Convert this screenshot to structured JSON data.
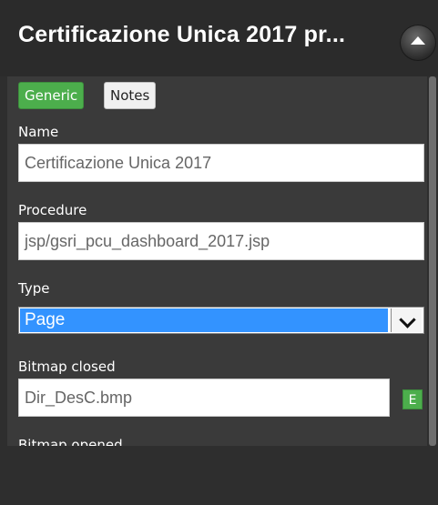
{
  "header": {
    "title": "Certificazione Unica 2017 pr..."
  },
  "tabs": [
    {
      "label": "Generic",
      "active": true
    },
    {
      "label": "Notes",
      "active": false
    }
  ],
  "fields": {
    "name": {
      "label": "Name",
      "value": "Certificazione Unica 2017"
    },
    "procedure": {
      "label": "Procedure",
      "value": "jsp/gsri_pcu_dashboard_2017.jsp"
    },
    "type": {
      "label": "Type",
      "value": "Page"
    },
    "bitmap_closed": {
      "label": "Bitmap closed",
      "value": "Dir_DesC.bmp",
      "edit_label": "E"
    },
    "bitmap_opened": {
      "label": "Bitmap opened"
    }
  },
  "colors": {
    "accent_green": "#4cae4c",
    "selection_blue": "#3393ff",
    "panel_bg": "#3a3a3a",
    "header_bg": "#2b2b2b"
  }
}
